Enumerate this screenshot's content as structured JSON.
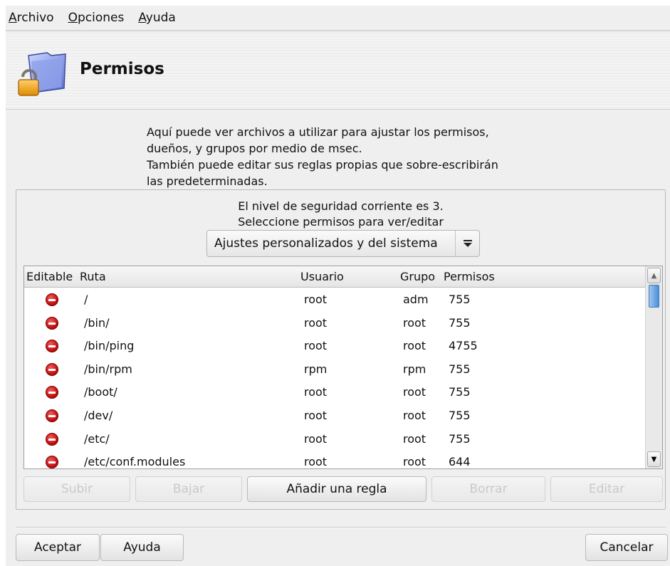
{
  "menubar": {
    "items": [
      {
        "first": "A",
        "rest": "rchivo"
      },
      {
        "first": "O",
        "rest": "pciones"
      },
      {
        "first": "A",
        "rest": "yuda"
      }
    ]
  },
  "banner": {
    "title": "Permisos",
    "icon": "lock-folder-icon"
  },
  "description": [
    "Aquí puede ver archivos a utilizar para ajustar los permisos,",
    "dueños, y grupos por medio de msec.",
    "También puede editar sus reglas propias que sobre-escribirán",
    "las predeterminadas."
  ],
  "security": {
    "level_text": "El nivel de seguridad corriente es 3.",
    "prompt": "Seleccione permisos para ver/editar",
    "selected_option": "Ajustes personalizados y del sistema"
  },
  "table": {
    "headers": {
      "editable": "Editable",
      "path": "Ruta",
      "user": "Usuario",
      "group": "Grupo",
      "perms": "Permisos"
    },
    "rows": [
      {
        "path": "/",
        "user": "root",
        "group": "adm",
        "perms": "755"
      },
      {
        "path": "/bin/",
        "user": "root",
        "group": "root",
        "perms": "755"
      },
      {
        "path": "/bin/ping",
        "user": "root",
        "group": "root",
        "perms": "4755"
      },
      {
        "path": "/bin/rpm",
        "user": "rpm",
        "group": "rpm",
        "perms": "755"
      },
      {
        "path": "/boot/",
        "user": "root",
        "group": "root",
        "perms": "755"
      },
      {
        "path": "/dev/",
        "user": "root",
        "group": "root",
        "perms": "755"
      },
      {
        "path": "/etc/",
        "user": "root",
        "group": "root",
        "perms": "755"
      },
      {
        "path": "/etc/conf.modules",
        "user": "root",
        "group": "root",
        "perms": "644"
      }
    ]
  },
  "actions": {
    "up": "Subir",
    "down": "Bajar",
    "add": "Añadir una regla",
    "delete": "Borrar",
    "edit": "Editar"
  },
  "footer": {
    "ok": "Aceptar",
    "help": "Ayuda",
    "cancel": "Cancelar"
  }
}
